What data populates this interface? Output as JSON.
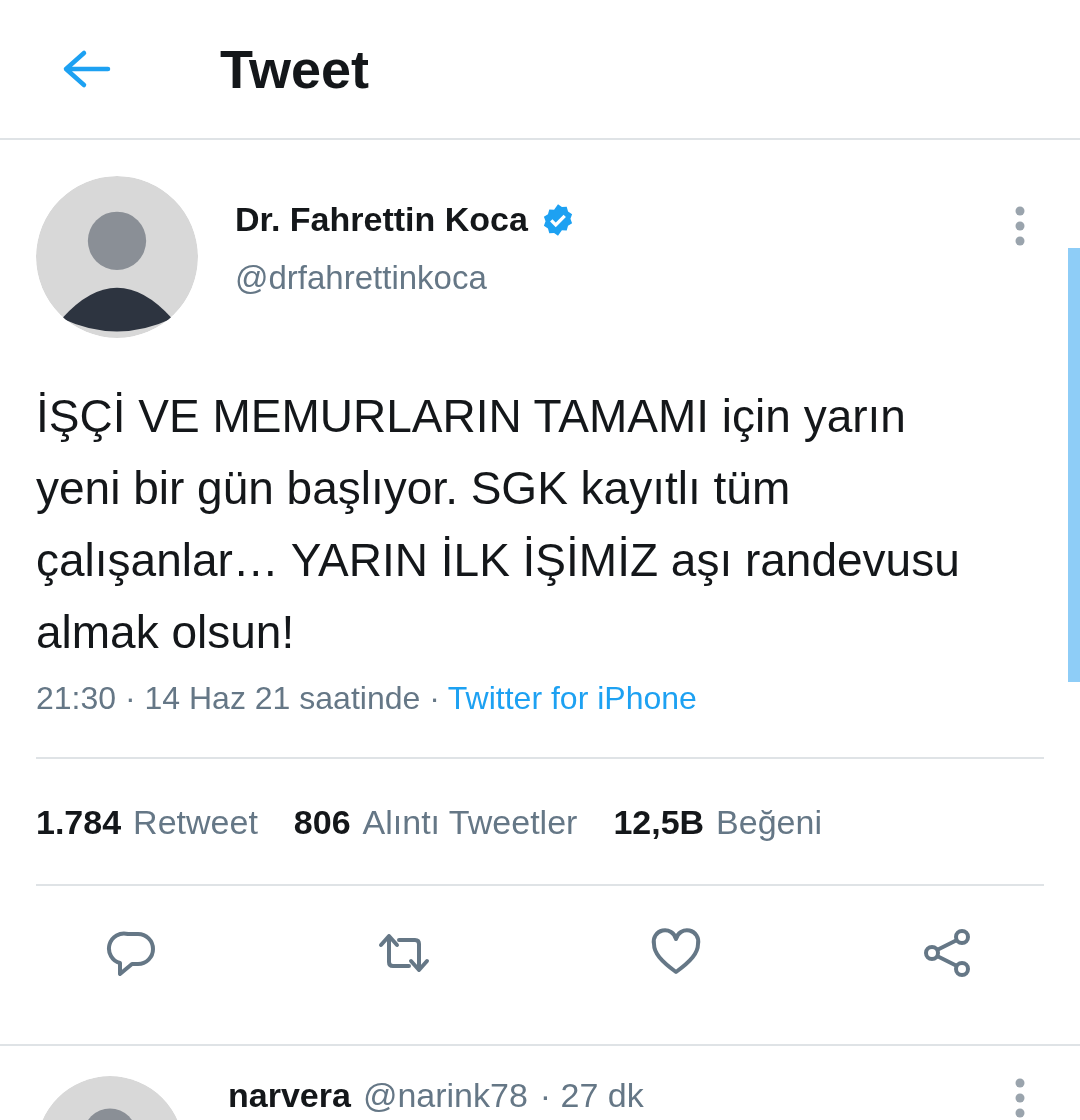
{
  "header": {
    "title": "Tweet"
  },
  "tweet": {
    "author": {
      "name": "Dr. Fahrettin Koca",
      "verified": true,
      "handle": "@drfahrettinkoca"
    },
    "text": "İŞÇİ VE MEMURLARIN TAMAMI için yarın yeni bir gün başlıyor. SGK kayıtlı tüm çalışanlar… YARIN İLK İŞİMİZ aşı randevusu almak olsun!",
    "time": "21:30 · 14 Haz 21 saatinde ·",
    "source": "Twitter for iPhone",
    "stats": [
      {
        "count": "1.784",
        "label": "Retweet"
      },
      {
        "count": "806",
        "label": "Alıntı Tweetler"
      },
      {
        "count": "12,5B",
        "label": "Beğeni"
      }
    ],
    "actions": [
      {
        "kind": "reply"
      },
      {
        "kind": "retweet"
      },
      {
        "kind": "like"
      },
      {
        "kind": "share"
      }
    ]
  },
  "replies": [
    {
      "name": "narvera",
      "handle": "@narink78",
      "time": "· 27 dk"
    }
  ]
}
